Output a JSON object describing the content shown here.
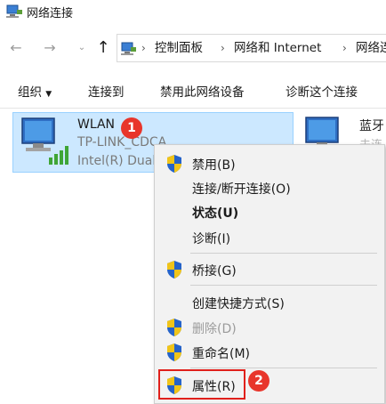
{
  "window": {
    "title": "网络连接"
  },
  "nav": {
    "back_icon": "arrow-left-icon",
    "forward_icon": "arrow-right-icon",
    "up_icon": "arrow-up-icon",
    "breadcrumb": [
      "控制面板",
      "网络和 Internet",
      "网络连"
    ]
  },
  "toolbar": {
    "organize": "组织",
    "connect": "连接到",
    "disable": "禁用此网络设备",
    "diagnose": "诊断这个连接"
  },
  "adapters": [
    {
      "name": "WLAN",
      "ssid": "TP-LINK_CDCA",
      "hardware": "Intel(R) Dual",
      "badge": "1"
    },
    {
      "name": "蓝牙",
      "sub": "未连"
    }
  ],
  "context_menu": {
    "items": [
      {
        "label": "禁用(B)",
        "icon": "uac-shield-icon"
      },
      {
        "label": "连接/断开连接(O)"
      },
      {
        "label": "状态(U)",
        "bold": true
      },
      {
        "label": "诊断(I)"
      },
      {
        "label": "桥接(G)",
        "icon": "uac-shield-icon"
      },
      {
        "label": "创建快捷方式(S)"
      },
      {
        "label": "删除(D)",
        "icon": "uac-shield-icon",
        "disabled": true
      },
      {
        "label": "重命名(M)",
        "icon": "uac-shield-icon"
      },
      {
        "label": "属性(R)",
        "icon": "uac-shield-icon"
      }
    ],
    "highlight_badge": "2"
  },
  "colors": {
    "selection_bg": "#cce8ff",
    "badge_red": "#e8352b",
    "highlight_border": "#e0201b"
  }
}
